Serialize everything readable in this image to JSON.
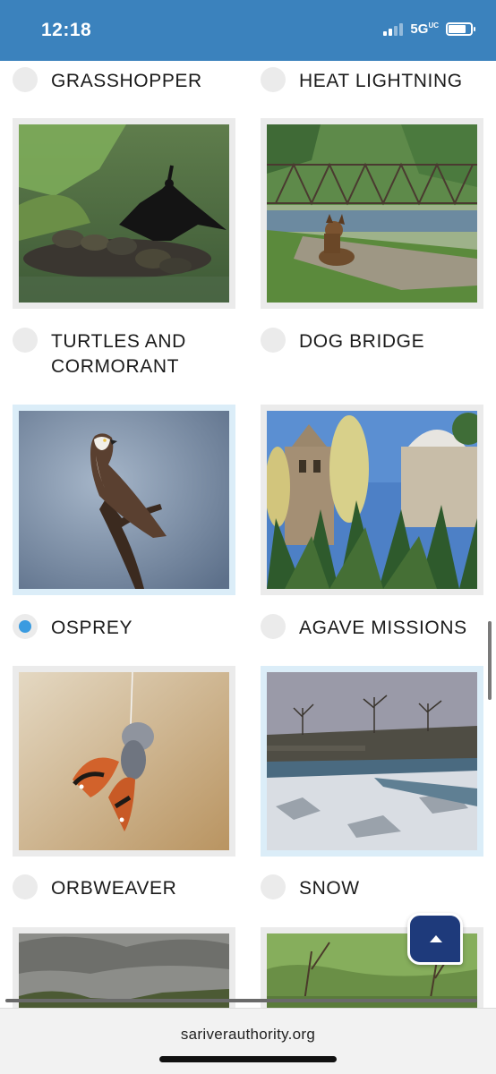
{
  "status_bar": {
    "time": "12:18",
    "network": "5G",
    "network_sup": "UC"
  },
  "gallery": {
    "options": [
      {
        "label": "GRASSHOPPER",
        "selected": false
      },
      {
        "label": "HEAT LIGHTNING",
        "selected": false
      },
      {
        "label": "TURTLES AND CORMORANT",
        "selected": false
      },
      {
        "label": "DOG BRIDGE",
        "selected": false
      },
      {
        "label": "OSPREY",
        "selected": true
      },
      {
        "label": "AGAVE MISSIONS",
        "selected": false
      },
      {
        "label": "ORBWEAVER",
        "selected": false
      },
      {
        "label": "SNOW",
        "selected": false
      }
    ]
  },
  "browser": {
    "url": "sariverauthority.org"
  },
  "icons": {
    "scroll_top": "chevron-up-icon",
    "radio": "radio-button-icon"
  },
  "colors": {
    "status_bar": "#3b82bd",
    "radio_selected": "#3a9be0",
    "scroll_top_button": "#1e3a7b"
  }
}
